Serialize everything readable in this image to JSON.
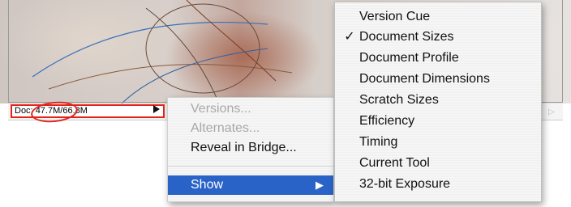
{
  "status_bar": {
    "doc_prefix": "Doc: ",
    "doc_value_1": "47.7M",
    "separator": "/",
    "doc_value_2": "66.8M",
    "arrow_icon": "triangle-right-icon",
    "scroll_icon": "scroll-right-icon",
    "annotation_color": "#e2231a"
  },
  "context_menu": {
    "items": [
      {
        "label": "Versions...",
        "enabled": false
      },
      {
        "label": "Alternates...",
        "enabled": false
      },
      {
        "label": "Reveal in Bridge...",
        "enabled": true
      },
      {
        "label": "Show",
        "enabled": true,
        "selected": true,
        "submenu_icon": "triangle-right-icon"
      }
    ],
    "selected_color": "#2a63c7"
  },
  "show_submenu": {
    "items": [
      {
        "label": "Version Cue",
        "checked": false
      },
      {
        "label": "Document Sizes",
        "checked": true,
        "check_mark": "✓"
      },
      {
        "label": "Document Profile",
        "checked": false
      },
      {
        "label": "Document Dimensions",
        "checked": false
      },
      {
        "label": "Scratch Sizes",
        "checked": false
      },
      {
        "label": "Efficiency",
        "checked": false
      },
      {
        "label": "Timing",
        "checked": false
      },
      {
        "label": "Current Tool",
        "checked": false
      },
      {
        "label": "32-bit Exposure",
        "checked": false
      }
    ]
  }
}
